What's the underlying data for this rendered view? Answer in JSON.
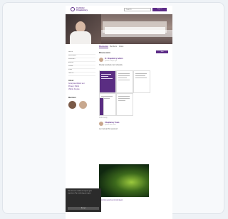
{
  "header": {
    "logo_text_1": "Catholic",
    "logo_text_2": "Chaplaincy",
    "search_placeholder": "Search",
    "signin_label": "Sign in"
  },
  "hero": {
    "title": ""
  },
  "tabs": [
    "Discussion",
    "Members",
    "About"
  ],
  "sidebar": {
    "items": [
      "About",
      "Discussion",
      "Members",
      "Events",
      "Media",
      "Files",
      "Search"
    ],
    "about_heading": "About",
    "about_lines": [
      "Group description text",
      "Privacy: Public",
      "Visible: Anyone"
    ],
    "members_heading": "Members"
  },
  "main": {
    "section_label": "Discussion",
    "join_label": "Join",
    "post1": {
      "name": "Fr. Chaplaincy Admin",
      "meta": "posted 2 days ago",
      "text": "Weekly newsletter and schedule"
    },
    "post2": {
      "name": "Chaplaincy Team",
      "meta": "posted last week",
      "text": "Lent retreat this weekend"
    },
    "post3_label": "Community",
    "post3_text": "Upcoming events and volunteers"
  },
  "cookie": {
    "text": "This site uses cookies to improve your experience. By continuing you agree.",
    "button": "Accept"
  }
}
